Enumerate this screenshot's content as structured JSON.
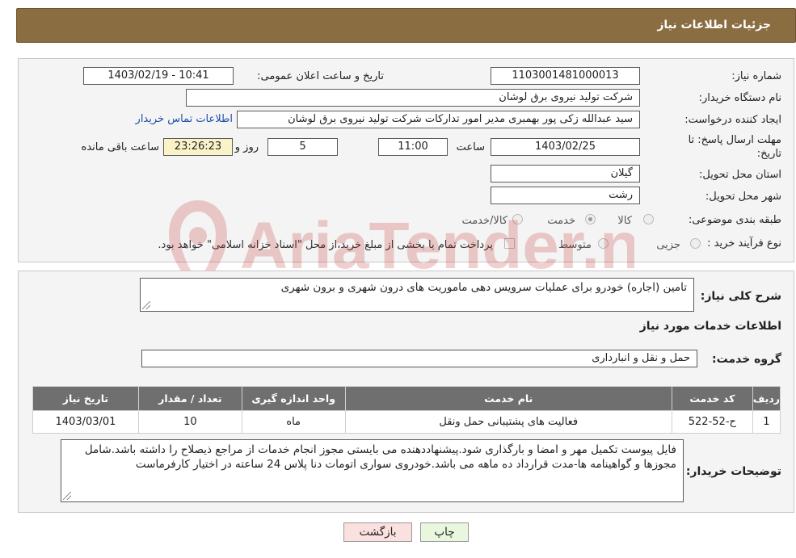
{
  "header": {
    "title": "جزئیات اطلاعات نیاز"
  },
  "info": {
    "need_number_label": "شماره نیاز:",
    "need_number": "1103001481000013",
    "announce_label": "تاریخ و ساعت اعلان عمومی:",
    "announce_value": "1403/02/19 - 10:41",
    "buyer_label": "نام دستگاه خریدار:",
    "buyer_value": "شرکت تولید نیروی برق لوشان",
    "creator_label": "ایجاد کننده درخواست:",
    "creator_value": "سید عبدالله زکی پور بهمبری مدیر امور تدارکات شرکت تولید نیروی برق لوشان",
    "contact_link": "اطلاعات تماس خریدار",
    "deadline_label_1": "مهلت ارسال پاسخ: تا",
    "deadline_label_2": "تاریخ:",
    "deadline_date": "1403/02/25",
    "time_label": "ساعت",
    "deadline_time": "11:00",
    "days_value": "5",
    "days_label": "روز و",
    "remaining_time": "23:26:23",
    "remaining_label": "ساعت باقی مانده",
    "province_label": "استان محل تحویل:",
    "province_value": "گیلان",
    "city_label": "شهر محل تحویل:",
    "city_value": "رشت",
    "category_label": "طبقه بندی موضوعی:",
    "category_options": [
      "کالا",
      "خدمت",
      "کالا/خدمت"
    ],
    "category_selected": "خدمت",
    "purchase_label": "نوع فرآیند خرید :",
    "purchase_options": [
      "جزیی",
      "متوسط"
    ],
    "payment_note": "پرداخت تمام یا بخشی از مبلغ خرید،از محل \"اسناد خزانه اسلامی\" خواهد بود."
  },
  "summary": {
    "label": "شرح کلی نیاز:",
    "value": "تامین (اجاره) خودرو برای عملیات سرویس دهی ماموریت های درون شهری و برون شهری",
    "services_title": "اطلاعات خدمات مورد نیاز",
    "group_label": "گروه خدمت:",
    "group_value": "حمل و نقل و انبارداری"
  },
  "table": {
    "headers": [
      "ردیف",
      "کد خدمت",
      "نام خدمت",
      "واحد اندازه گیری",
      "تعداد / مقدار",
      "تاریخ نیاز"
    ],
    "rows": [
      [
        "1",
        "ح-52-522",
        "فعالیت های پشتیبانی حمل ونقل",
        "ماه",
        "10",
        "1403/03/01"
      ]
    ]
  },
  "buyer_notes": {
    "label": "توضیحات خریدار:",
    "value": "فایل پیوست تکمیل مهر و امضا و بارگذاری شود.پیشنهاددهنده می بایستی مجوز انجام خدمات از مراجع ذیصلاح را داشته باشد.شامل مجوزها و گواهینامه ها-مدت قرارداد ده ماهه می باشد.خودروی سواری اتومات دنا پلاس 24 ساعته در اختیار کارفرماست"
  },
  "buttons": {
    "print": "چاپ",
    "back": "بازگشت"
  },
  "watermark": {
    "text": "AriaTender.neT"
  },
  "colors": {
    "header": "#8b6d42",
    "table_header": "#6f6f6f",
    "link": "#1f4fa8",
    "watermark": "#c62828"
  }
}
